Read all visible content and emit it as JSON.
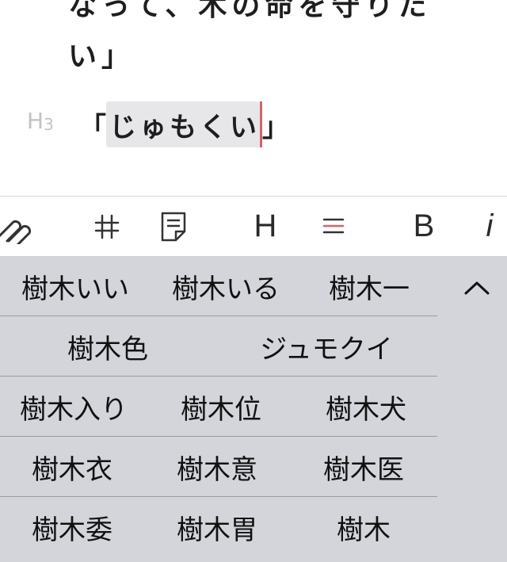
{
  "editor": {
    "prev_line_1": "なって、木の命を守りた",
    "prev_line_2": "い」",
    "heading_marker": "H",
    "heading_marker_level": "3",
    "open_bracket": "「",
    "composing_text": "じゅもくい",
    "close_bracket": "」"
  },
  "toolbar": {
    "items": [
      {
        "name": "link-icon"
      },
      {
        "name": "strikethrough-icon"
      },
      {
        "name": "note-icon"
      },
      {
        "name": "heading",
        "label": "H"
      },
      {
        "name": "list-icon"
      },
      {
        "name": "bold",
        "label": "B"
      },
      {
        "name": "italic",
        "label": "i"
      }
    ],
    "accent_color": "#d4636c"
  },
  "candidates": {
    "rows": [
      [
        "樹木いい",
        "樹木いる",
        "樹木一"
      ],
      [
        "樹木色",
        "ジュモクイ"
      ],
      [
        "樹木入り",
        "樹木位",
        "樹木犬"
      ],
      [
        "樹木衣",
        "樹木意",
        "樹木医"
      ],
      [
        "樹木委",
        "樹木胃",
        "樹木"
      ]
    ],
    "collapse_icon": "chevron-up-icon"
  }
}
